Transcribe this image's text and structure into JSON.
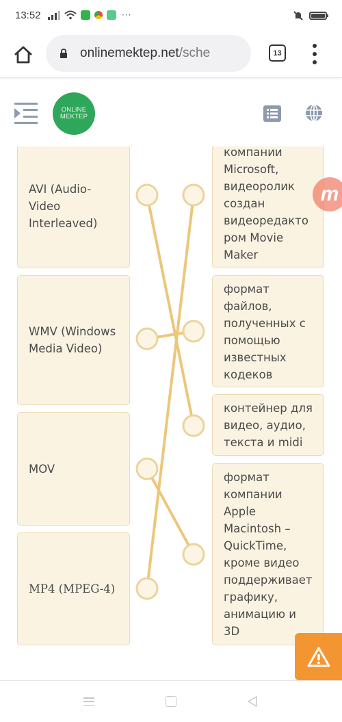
{
  "status_bar": {
    "time": "13:52",
    "app_icons": [
      "whatsapp-icon",
      "chrome-icon",
      "app-icon"
    ],
    "more": "···"
  },
  "browser": {
    "url_host": "onlinemektep.net",
    "url_path": "/sche",
    "tab_count": "13"
  },
  "site": {
    "logo_line1": "ONLINE",
    "logo_line2": "MEKTEP",
    "brand_badge": "m",
    "colors": {
      "logo_green": "#2fa75a",
      "card_bg": "#fbf3e2",
      "card_border": "#ecdcb5",
      "link_line": "#ecc77a",
      "report_orange": "#f39631"
    }
  },
  "exercise": {
    "left_items": [
      {
        "id": "avi",
        "label": "AVI (Audio-Video Interleaved)",
        "lines": [
          "AVI (Audio-",
          "Video",
          "Interleaved)"
        ]
      },
      {
        "id": "wmv",
        "label": "WMV (Windows Media Video)",
        "lines": [
          "WMV (Windows",
          "Media Video)"
        ]
      },
      {
        "id": "mov",
        "label": "MOV",
        "lines": [
          "MOV"
        ]
      },
      {
        "id": "mp4",
        "label": "MP4 (MPEG-4)",
        "lines": [
          "MP4 (MPEG-4)"
        ]
      }
    ],
    "right_items": [
      {
        "id": "r1",
        "lines": [
          "компании",
          "Microsoft,",
          "видеоролик",
          "создан",
          "видеоредакто",
          "ром Movie",
          "Maker"
        ]
      },
      {
        "id": "r2",
        "lines": [
          "формат",
          "файлов,",
          "полученных с",
          "помощью",
          "известных",
          "кодеков"
        ]
      },
      {
        "id": "r3",
        "lines": [
          "контейнер для",
          "видео, аудио,",
          "текста и midi"
        ]
      },
      {
        "id": "r4",
        "lines": [
          "формат",
          "компании",
          "Apple",
          "Macintosh –",
          "QuickTime,",
          "кроме видео",
          "поддерживает",
          "графику,",
          "анимацию и",
          "3D"
        ]
      }
    ],
    "connections": [
      {
        "from": "avi",
        "to": "r3"
      },
      {
        "from": "wmv",
        "to": "r2"
      },
      {
        "from": "mov",
        "to": "r4"
      },
      {
        "from": "mp4",
        "to": "r1"
      }
    ]
  }
}
